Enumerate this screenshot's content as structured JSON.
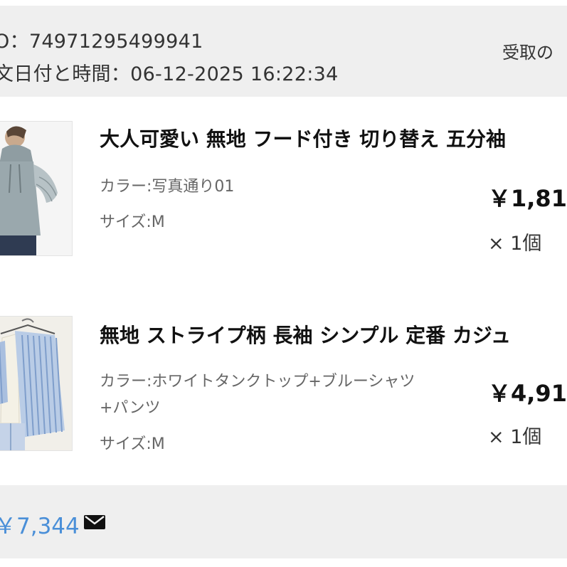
{
  "order": {
    "number_text": "O：74971295499941",
    "date_text": "文日付と時間：06-12-2025 16:22:34",
    "receive_label": "受取の"
  },
  "items": [
    {
      "title": "大人可愛い 無地 フード付き 切り替え 五分袖",
      "color": "カラー:写真通り01",
      "size": "サイズ:M",
      "price": "￥1,81",
      "qty": "× 1個",
      "image": "gray-hooded-top-photo"
    },
    {
      "title": "無地 ストライプ柄 長袖 シンプル 定番 カジュ",
      "color": "カラー:ホワイトタンクトップ+ブルーシャツ+パンツ",
      "size": "サイズ:M",
      "price": "￥4,91",
      "qty": "× 1個",
      "image": "blue-striped-shirt-set-photo"
    }
  ],
  "footer": {
    "total": "￥7,344",
    "icon": "mail-icon"
  },
  "colors": {
    "header_bg": "#efefef",
    "total_blue": "#4a8fd8"
  }
}
